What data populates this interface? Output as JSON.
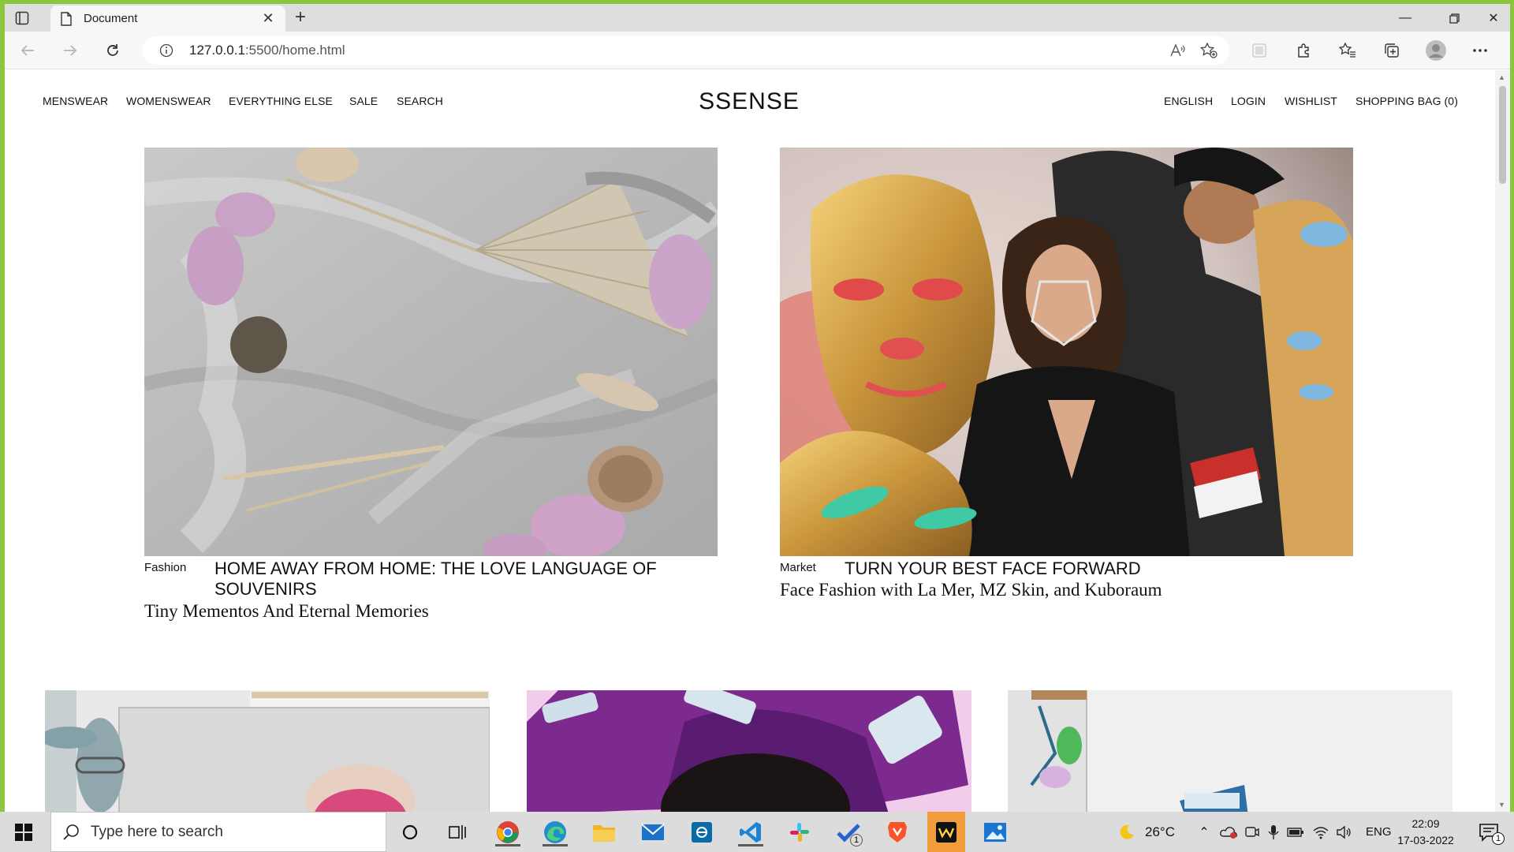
{
  "browser": {
    "tab_title": "Document",
    "new_tab": "+",
    "url_host": "127.0.0.1",
    "url_path": ":5500/home.html"
  },
  "site": {
    "logo": "SSENSE",
    "nav_left": [
      "MENSWEAR",
      "WOMENSWEAR",
      "EVERYTHING ELSE",
      "SALE",
      "SEARCH"
    ],
    "nav_right": [
      "ENGLISH",
      "LOGIN",
      "WISHLIST",
      "SHOPPING BAG (0)"
    ]
  },
  "features": [
    {
      "category": "Fashion",
      "headline_line1": "HOME AWAY FROM HOME: THE LOVE LANGUAGE OF",
      "headline_line2": "SOUVENIRS",
      "subtitle": "Tiny Mementos And Eternal Memories"
    },
    {
      "category": "Market",
      "headline_line1": "TURN YOUR BEST FACE FORWARD",
      "subtitle": "Face Fashion with La Mer, MZ Skin, and Kuboraum"
    }
  ],
  "taskbar": {
    "search_placeholder": "Type here to search",
    "weather": "26°C",
    "language": "ENG",
    "time": "22:09",
    "date": "17-03-2022",
    "notification_count": "1",
    "todo_badge": "1"
  },
  "colors": {
    "window_frame": "#8cc63f",
    "tab_bar": "#dedede",
    "taskbar": "#dcdcdc"
  }
}
